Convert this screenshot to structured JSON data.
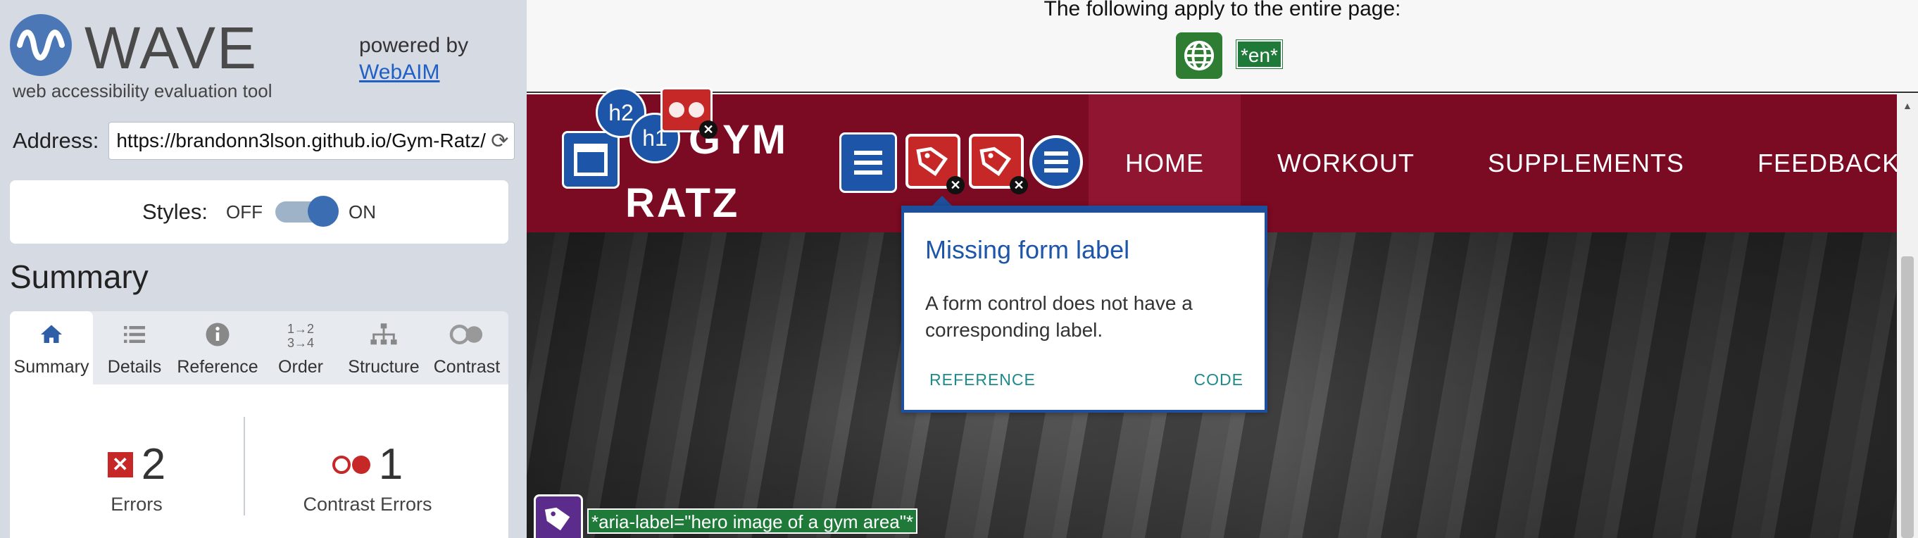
{
  "wave": {
    "logo_text": "WAVE",
    "tagline": "web accessibility evaluation tool",
    "powered_by": "powered by",
    "webaim_link": "WebAIM",
    "address_label": "Address:",
    "address_value": "https://brandonn3lson.github.io/Gym-Ratz/",
    "styles_label": "Styles:",
    "styles_off": "OFF",
    "styles_on": "ON",
    "styles_state": "on",
    "summary_heading": "Summary",
    "tabs": [
      {
        "label": "Summary",
        "icon": "home-icon"
      },
      {
        "label": "Details",
        "icon": "list-icon"
      },
      {
        "label": "Reference",
        "icon": "info-icon"
      },
      {
        "label": "Order",
        "icon": "order-icon"
      },
      {
        "label": "Structure",
        "icon": "structure-icon"
      },
      {
        "label": "Contrast",
        "icon": "contrast-icon"
      }
    ],
    "active_tab": "Summary",
    "errors": {
      "count": "2",
      "label": "Errors"
    },
    "contrast_errors": {
      "count": "1",
      "label": "Contrast Errors"
    }
  },
  "page": {
    "doc_text": "The following apply to the entire page:",
    "lang_tag": "*en*",
    "brand_line1": "GYM",
    "brand_line2": "RATZ",
    "nav": [
      "HOME",
      "WORKOUT",
      "SUPPLEMENTS",
      "FEEDBACK"
    ],
    "active_nav": "HOME",
    "h2_badge": "h2",
    "h1_badge": "h1",
    "aria_label": "*aria-label=\"hero image of a gym area\"*"
  },
  "tooltip": {
    "title": "Missing form label",
    "body": "A form control does not have a corresponding label.",
    "reference": "REFERENCE",
    "code": "CODE"
  },
  "colors": {
    "wave_blue": "#4b77b6",
    "navbar": "#7b0a23",
    "error_red": "#c62828",
    "lang_green": "#1f7a3a",
    "tooltip_border": "#1d4f9c"
  }
}
